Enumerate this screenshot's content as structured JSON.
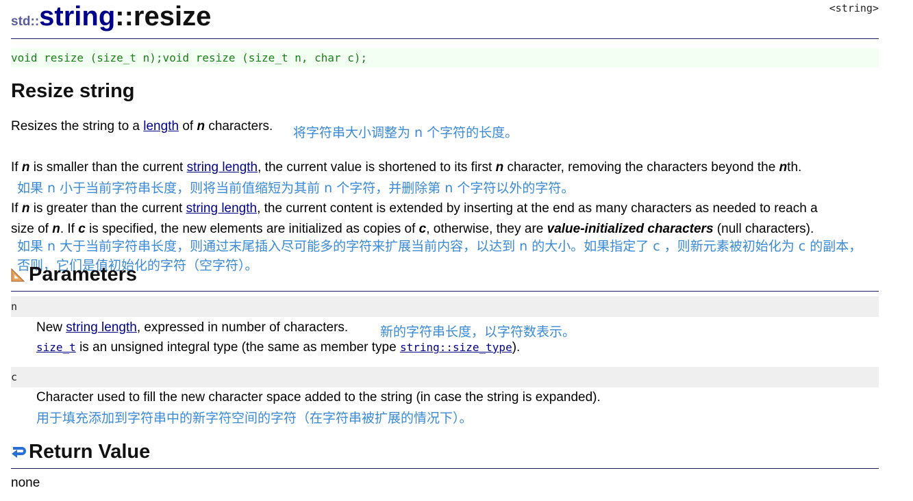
{
  "header": {
    "namespace": "std::",
    "class_name": "string",
    "member_name": "::resize",
    "include": "<string>"
  },
  "prototype": {
    "text": "void resize (size_t n);void resize (size_t n, char c);"
  },
  "description": {
    "title": "Resize string",
    "intro": {
      "before": "Resizes the string to a ",
      "link": "length",
      "middle": " of ",
      "n": "n",
      "after": " characters.",
      "translation": "将字符串大小调整为 n 个字符的长度。"
    },
    "para1": {
      "p1": "If ",
      "n1": "n",
      "p2": " is smaller than the current ",
      "link": "string length",
      "p3": ", the current value is shortened to its first ",
      "n2": "n",
      "p4": " character, removing the characters beyond the ",
      "n3": "n",
      "p5": "th.",
      "translation": "如果 n 小于当前字符串长度，则将当前值缩短为其前 n 个字符，并删除第 n 个字符以外的字符。"
    },
    "para2": {
      "p1": "If ",
      "n1": "n",
      "p2": " is greater than the current ",
      "link": "string length",
      "p3": ", the current content is extended by inserting at the end as many characters as needed to reach a",
      "p4": "size of ",
      "n2": "n",
      "p5": ". If ",
      "c1": "c",
      "p6": " is specified, the new elements are initialized as copies of ",
      "c2": "c",
      "p7": ", otherwise, they are ",
      "vi": "value-initialized characters",
      "p8": " (null characters).",
      "translation_line1": "如果 n 大于当前字符串长度，则通过末尾插入尽可能多的字符来扩展当前内容，以达到 n 的大小。如果指定了 c ，则新元素被初始化为 c 的副本，",
      "translation_line2": "否则，它们是值初始化的字符（空字符）。"
    }
  },
  "parameters": {
    "title": "Parameters",
    "items": [
      {
        "name": "n",
        "desc_before": "New ",
        "desc_link": "string length",
        "desc_after": ", expressed in number of characters.",
        "translation": "新的字符串长度，以字符数表示。",
        "type_link": "size_t",
        "type_text": " is an unsigned integral type (the same as member type ",
        "member_link": "string::size_type",
        "type_end": ")."
      },
      {
        "name": "c",
        "desc": "Character used to fill the new character space added to the string (in case the string is expanded).",
        "translation": "用于填充添加到字符串中的新字符空间的字符（在字符串被扩展的情况下）。"
      }
    ]
  },
  "return_value": {
    "title": "Return Value",
    "text": "none"
  },
  "colors": {
    "title_blue": "#00008b",
    "namespace_purple": "#5b5b9b",
    "code_green": "#1a7f1a",
    "code_bg": "#f3fff3",
    "translation_blue": "#3a8ad6",
    "param_bg": "#efefef",
    "rule": "#1a1a5e"
  },
  "icons": [
    "ruler-triangle-icon",
    "return-arrow-icon"
  ]
}
